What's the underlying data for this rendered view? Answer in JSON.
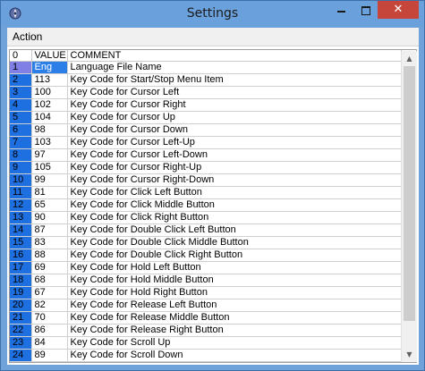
{
  "window": {
    "title": "Settings",
    "close_label": "✕"
  },
  "menu": {
    "action": "Action"
  },
  "grid": {
    "columns": [
      "0",
      "VALUE",
      "COMMENT"
    ],
    "rows": [
      {
        "index": "1",
        "value": "Eng",
        "comment": "Language File Name"
      },
      {
        "index": "2",
        "value": "113",
        "comment": "Key Code for Start/Stop Menu Item"
      },
      {
        "index": "3",
        "value": "100",
        "comment": "Key Code for Cursor Left"
      },
      {
        "index": "4",
        "value": "102",
        "comment": "Key Code for Cursor Right"
      },
      {
        "index": "5",
        "value": "104",
        "comment": "Key Code for Cursor Up"
      },
      {
        "index": "6",
        "value": "98",
        "comment": "Key Code for Cursor Down"
      },
      {
        "index": "7",
        "value": "103",
        "comment": "Key Code for Cursor Left-Up"
      },
      {
        "index": "8",
        "value": "97",
        "comment": "Key Code for Cursor Left-Down"
      },
      {
        "index": "9",
        "value": "105",
        "comment": "Key Code for Cursor Right-Up"
      },
      {
        "index": "10",
        "value": "99",
        "comment": "Key Code for Cursor Right-Down"
      },
      {
        "index": "11",
        "value": "81",
        "comment": "Key Code for Click Left Button"
      },
      {
        "index": "12",
        "value": "65",
        "comment": "Key Code for Click Middle Button"
      },
      {
        "index": "13",
        "value": "90",
        "comment": "Key Code for Click Right Button"
      },
      {
        "index": "14",
        "value": "87",
        "comment": "Key Code for Double Click Left Button"
      },
      {
        "index": "15",
        "value": "83",
        "comment": "Key Code for Double Click Middle Button"
      },
      {
        "index": "16",
        "value": "88",
        "comment": "Key Code for Double Click Right Button"
      },
      {
        "index": "17",
        "value": "69",
        "comment": "Key Code for Hold Left Button"
      },
      {
        "index": "18",
        "value": "68",
        "comment": "Key Code for Hold Middle Button"
      },
      {
        "index": "19",
        "value": "67",
        "comment": "Key Code for Hold Right Button"
      },
      {
        "index": "20",
        "value": "82",
        "comment": "Key Code for Release Left Button"
      },
      {
        "index": "21",
        "value": "70",
        "comment": "Key Code for Release Middle Button"
      },
      {
        "index": "22",
        "value": "86",
        "comment": "Key Code for Release Right Button"
      },
      {
        "index": "23",
        "value": "84",
        "comment": "Key Code for Scroll Up"
      },
      {
        "index": "24",
        "value": "89",
        "comment": "Key Code for Scroll Down"
      }
    ]
  },
  "scrollbar": {
    "up_glyph": "▲",
    "down_glyph": "▼"
  },
  "colors": {
    "titlebar": "#6aa1dc",
    "close_button": "#c7463c",
    "row_index_fill": "#1e6fe0",
    "selected_cell": "#2d7fe8"
  },
  "icons": {
    "app": "app-gear-icon",
    "minimize": "minimize-icon",
    "maximize": "maximize-icon",
    "close": "close-icon"
  }
}
